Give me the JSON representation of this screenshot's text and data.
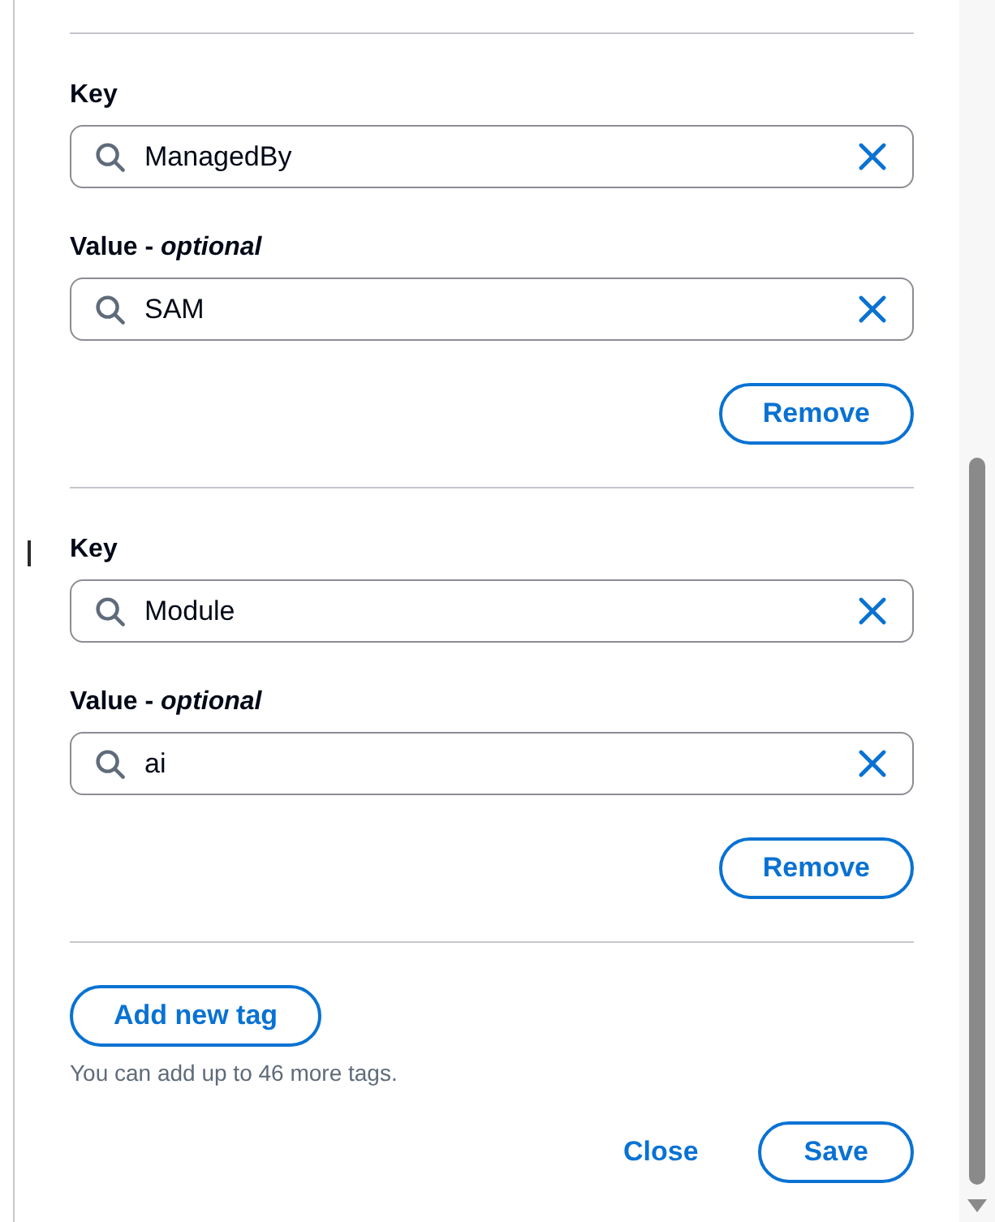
{
  "tags": [
    {
      "key_field": {
        "label": "Key",
        "value": "ManagedBy"
      },
      "value_field": {
        "label": "Value - *optional*",
        "value": "SAM"
      },
      "remove_button": "Remove"
    },
    {
      "key_field": {
        "label": "Key",
        "value": "Module"
      },
      "value_field": {
        "label": "Value - *optional*",
        "value": "ai"
      },
      "remove_button": "Remove"
    }
  ],
  "add_button": "Add new tag",
  "hint": "You can add up to 46 more tags.",
  "footer_buttons": [
    {
      "label": "Close",
      "kind": "link"
    },
    {
      "label": "Save",
      "kind": "outline"
    }
  ]
}
